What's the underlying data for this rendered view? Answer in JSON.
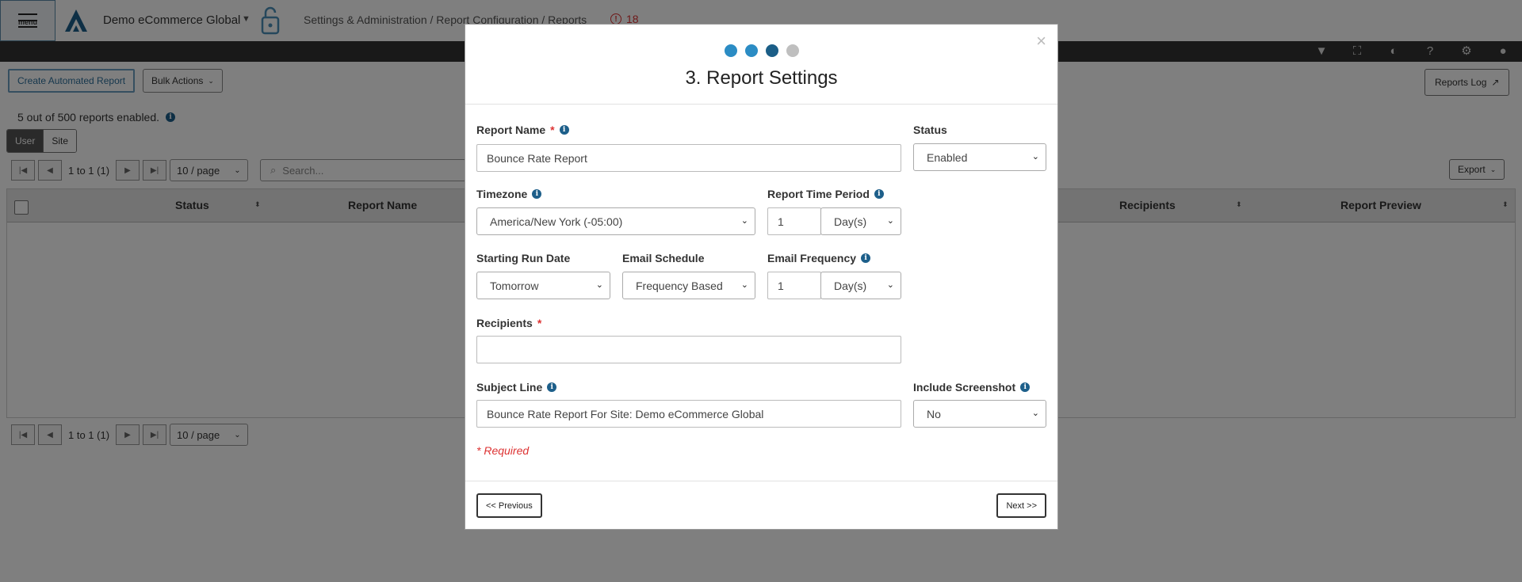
{
  "header": {
    "menu_label": "menu",
    "site_name": "Demo eCommerce Global",
    "breadcrumb": "Settings & Administration / Report Configuration / Reports",
    "alert_count": "18"
  },
  "toolbar": {
    "create_label": "Create Automated Report",
    "bulk_label": "Bulk Actions",
    "reports_log_label": "Reports Log",
    "export_label": "Export"
  },
  "summary": {
    "enabled_text": "5 out of 500 reports enabled."
  },
  "scope_toggle": {
    "user": "User",
    "site": "Site"
  },
  "pager": {
    "range": "1 to 1 (1)",
    "page_size": "10 / page"
  },
  "search": {
    "placeholder": "Search..."
  },
  "table": {
    "columns": [
      "Status",
      "Report Name",
      "Recipients",
      "Report Preview"
    ]
  },
  "modal": {
    "steps": [
      {
        "state": "done",
        "color": "#2b8cc4"
      },
      {
        "state": "done",
        "color": "#2b8cc4"
      },
      {
        "state": "current",
        "color": "#1b5e87"
      },
      {
        "state": "todo",
        "color": "#bfbfbf"
      }
    ],
    "title": "3. Report Settings",
    "fields": {
      "report_name": {
        "label": "Report Name",
        "value": "Bounce Rate Report"
      },
      "status": {
        "label": "Status",
        "value": "Enabled"
      },
      "timezone": {
        "label": "Timezone",
        "value": "America/New York (-05:00)"
      },
      "report_time_period": {
        "label": "Report Time Period",
        "amount": "1",
        "unit": "Day(s)"
      },
      "starting_run_date": {
        "label": "Starting Run Date",
        "value": "Tomorrow"
      },
      "email_schedule": {
        "label": "Email Schedule",
        "value": "Frequency Based"
      },
      "email_frequency": {
        "label": "Email Frequency",
        "amount": "1",
        "unit": "Day(s)"
      },
      "recipients": {
        "label": "Recipients",
        "value": ""
      },
      "subject_line": {
        "label": "Subject Line",
        "value": "Bounce Rate Report For Site: Demo eCommerce Global"
      },
      "include_screenshot": {
        "label": "Include Screenshot",
        "value": "No"
      }
    },
    "required_marker": "*",
    "required_note": "* Required",
    "previous_label": "<< Previous",
    "next_label": "Next >>"
  }
}
